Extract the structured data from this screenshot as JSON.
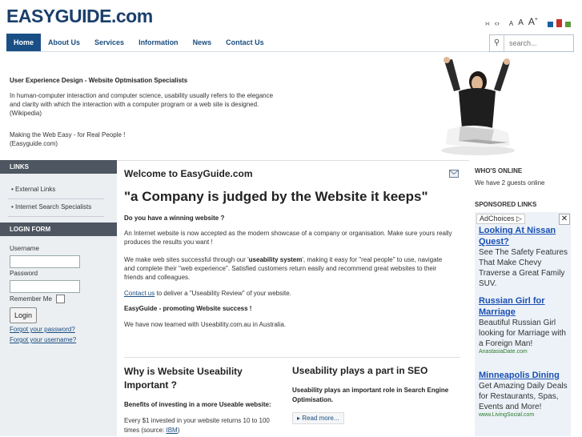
{
  "header": {
    "logo": "EASYGUIDE.com",
    "tools": {
      "rtl": "›‹",
      "ltr": "‹›",
      "font_small": "A",
      "font_medium": "A",
      "font_large": "A",
      "font_plus": "+"
    },
    "color_squares": [
      "#1a5f9f",
      "#c8302a",
      "#5a9a3a"
    ]
  },
  "nav": {
    "items": [
      {
        "label": "Home",
        "active": true
      },
      {
        "label": "About Us"
      },
      {
        "label": "Services"
      },
      {
        "label": "Information"
      },
      {
        "label": "News"
      },
      {
        "label": "Contact Us"
      }
    ],
    "search_placeholder": "search..."
  },
  "hero": {
    "title": "User Experience Design - Website Optmisation Specialists",
    "p1": "In human-computer interaction and computer science, usability usually refers to the elegance and clarity with which the interaction with a computer program or a web site is designed. (Wikipedia)",
    "p2_line1": "Making the Web Easy - for Real People !",
    "p2_line2": "(Easyguide.com)"
  },
  "left": {
    "links_head": "LINKS",
    "links": [
      "External Links",
      "Internet Search Specialists"
    ],
    "login_head": "LOGIN FORM",
    "username_label": "Username",
    "password_label": "Password",
    "remember_label": "Remember Me",
    "login_button": "Login",
    "forgot_password": "Forgot your password?",
    "forgot_username": "Forgot your username?"
  },
  "content": {
    "welcome": "Welcome to EasyGuide.com",
    "quote": "\"a Company is judged by the Website it keeps\"",
    "q_winning": "Do you have a winning website ?",
    "p_showcase": "An Internet website is now accepted as the modern showcase of a company or organisation. Make sure yours really produces the results you want !",
    "p_success_pre": "We make web sites successful through our '",
    "p_success_bold": "useability system",
    "p_success_post": "', making it easy for \"real people\" to use, navigate and complete their \"web experience\". Satisfied customers return easily and recommend great websites to their friends and colleagues.",
    "contact_link": "Contact us",
    "contact_rest": " to deliver a \"Useability Review\" of your website.",
    "promo": "EasyGuide - promoting Website success !",
    "team": "We have now teamed with Useability.com.au in Australia.",
    "col1_title": "Why is Website Useability Important ?",
    "col1_sub": "Benefits of investing in a more Useable website:",
    "col1_text_pre": "Every $1 invested in your website returns 10 to 100 times (source: ",
    "col1_ibm": "IBM",
    "col1_text_post": ")",
    "col2_title": "Useability plays a part in SEO",
    "col2_sub": "Useability plays an important role in Search Engine Optimisation.",
    "read_more": "Read more..."
  },
  "right": {
    "whos_online_head": "WHO'S ONLINE",
    "whos_online_text": "We have 2 guests online",
    "sponsored_head": "SPONSORED LINKS",
    "adchoices": "AdChoices",
    "ads": [
      {
        "title": "Looking At Nissan Quest?",
        "body": "See The Safety Features That Make Chevy Traverse a Great Family SUV.",
        "url": ""
      },
      {
        "title": "Russian Girl for Marriage",
        "body": "Beautiful Russian Girl looking for Marriage with a Foreign Man!",
        "url": "AnastasiaDate.com"
      },
      {
        "title": "Minneapolis Dining",
        "body": "Get Amazing Daily Deals for Restaurants, Spas, Events and More!",
        "url": "www.LivingSocial.com"
      }
    ]
  }
}
